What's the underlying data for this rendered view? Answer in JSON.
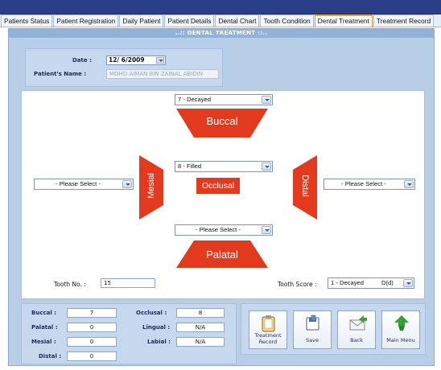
{
  "tabs": [
    "Patients Status",
    "Patient Registration",
    "Daily Patient",
    "Patient Details",
    "Dental Chart",
    "Tooth Condition",
    "Dental Treatment",
    "Treatment Record"
  ],
  "active_tab": "Dental Treatment",
  "panel_title": "..:: DENTAL TREATMENT ::..",
  "info": {
    "date_label": "Date :",
    "date_value": "12/ 6/2009",
    "name_label": "Patient's Name :",
    "name_value": "MOHD AIMAN BIN ZAINAL ABIDIN"
  },
  "surfaces": {
    "buccal": {
      "label": "Buccal",
      "selected": "7 - Decayed"
    },
    "occlusal": {
      "label": "Occlusal",
      "selected": "8 - Filled"
    },
    "palatal": {
      "label": "Palatal",
      "selected": "- Please Select -"
    },
    "mesial": {
      "label": "Mesial",
      "selected": "- Please Select -"
    },
    "distal": {
      "label": "Distal",
      "selected": "- Please Select -"
    }
  },
  "tooth": {
    "no_label": "Tooth No. :",
    "no_value": "15",
    "score_label": "Tooth Score :",
    "score_value": "1 - Decayed",
    "score_code": "D(d)"
  },
  "summary": {
    "buccal_label": "Buccal :",
    "buccal_value": "7",
    "palatal_label": "Palatal :",
    "palatal_value": "0",
    "mesial_label": "Mesial :",
    "mesial_value": "0",
    "distal_label": "Distal :",
    "distal_value": "0",
    "occlusal_label": "Occlusal :",
    "occlusal_value": "8",
    "lingual_label": "Lingual :",
    "lingual_value": "N/A",
    "labial_label": "Labial :",
    "labial_value": "N/A"
  },
  "buttons": {
    "treatment_record_line1": "Treatment",
    "treatment_record_line2": "Record",
    "save": "Save",
    "back": "Back",
    "main_menu": "Main Menu"
  },
  "colors": {
    "surface_red": "#e33a1e",
    "panel_bg": "#b8cde6",
    "topbar": "#2a3f88"
  },
  "icons": [
    "clipboard-icon",
    "save-icon",
    "back-envelope-icon",
    "home-arrow-icon"
  ]
}
